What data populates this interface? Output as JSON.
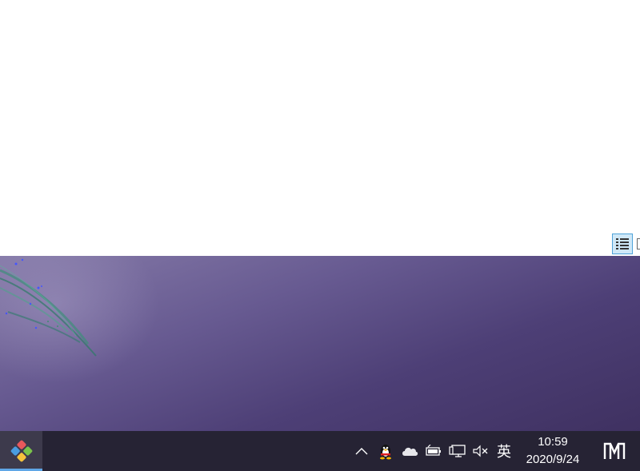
{
  "taskbar": {
    "tray": {
      "input_method": "英"
    },
    "clock": {
      "time": "10:59",
      "date": "2020/9/24"
    }
  },
  "icons": {
    "start": "windows-start-logo",
    "chevron": "chevron-up-icon",
    "qq": "qq-penguin-icon",
    "onedrive": "cloud-icon",
    "battery": "battery-icon",
    "network": "network-icon",
    "volume": "volume-muted-icon",
    "notification": "action-center-icon"
  },
  "colors": {
    "taskbar_bg": "#262334",
    "start_bg": "#3d3a4c",
    "accent": "#5fa6e6",
    "view_toggle_bg": "#cfe8f8"
  }
}
